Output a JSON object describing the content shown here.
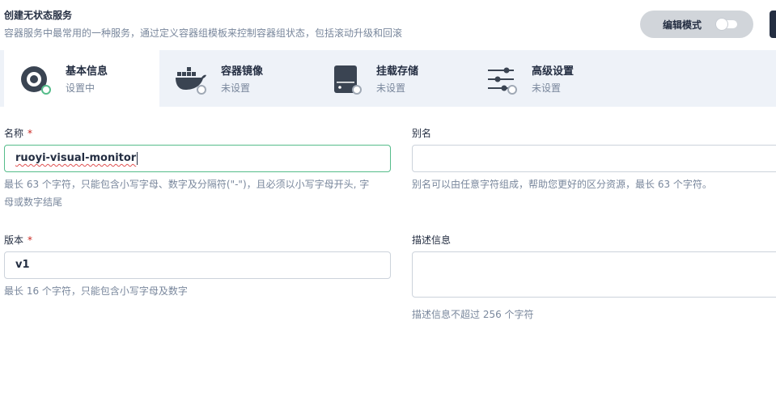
{
  "header": {
    "title": "创建无状态服务",
    "description": "容器服务中最常用的一种服务，通过定义容器组模板来控制容器组状态，包括滚动升级和回滚",
    "edit_mode_label": "编辑模式"
  },
  "steps": [
    {
      "name": "基本信息",
      "status": "设置中",
      "icon": "basic-info-icon"
    },
    {
      "name": "容器镜像",
      "status": "未设置",
      "icon": "docker-whale-icon"
    },
    {
      "name": "挂载存储",
      "status": "未设置",
      "icon": "storage-disk-icon"
    },
    {
      "name": "高级设置",
      "status": "未设置",
      "icon": "sliders-icon"
    }
  ],
  "form": {
    "name": {
      "label": "名称",
      "required_mark": "*",
      "value": "ruoyi-visual-monitor",
      "hint_line1": "最长 63 个字符，只能包含小写字母、数字及分隔符(\"-\")，且必须以小写字母开头, 字",
      "hint_line2": "母或数字结尾"
    },
    "alias": {
      "label": "别名",
      "value": "",
      "hint": "别名可以由任意字符组成，帮助您更好的区分资源，最长 63 个字符。"
    },
    "version": {
      "label": "版本",
      "required_mark": "*",
      "value": "v1",
      "hint": "最长 16 个字符，只能包含小写字母及数字"
    },
    "description": {
      "label": "描述信息",
      "value": "",
      "hint": "描述信息不超过 256 个字符"
    }
  },
  "colors": {
    "accent_green": "#55bc8a",
    "required_red": "#ca2621",
    "step_bar_bg": "#eef2f8",
    "text_dark": "#242e42",
    "text_muted": "#79879c"
  }
}
